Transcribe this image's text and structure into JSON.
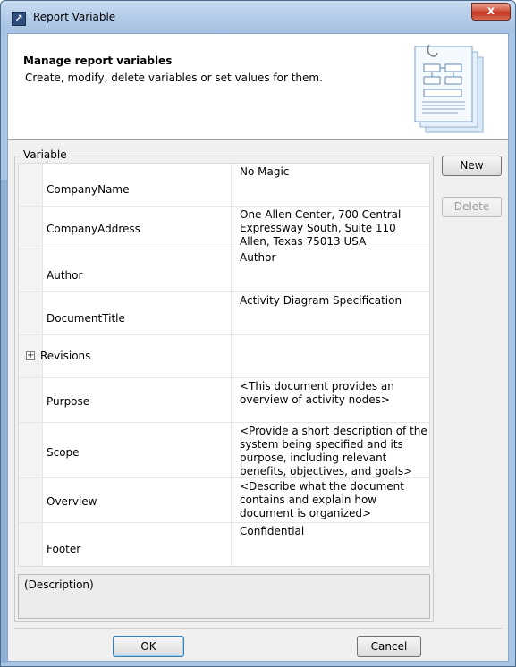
{
  "window": {
    "title": "Report Variable",
    "close_label": "x"
  },
  "header": {
    "title": "Manage report variables",
    "description": "Create, modify, delete variables or set values for them."
  },
  "group": {
    "label": "Variable"
  },
  "variables": [
    {
      "name": "CompanyName",
      "value": "No Magic",
      "expandable": false
    },
    {
      "name": "CompanyAddress",
      "value": "One Allen Center, 700 Central Expressway South, Suite 110 Allen, Texas 75013 USA",
      "expandable": false
    },
    {
      "name": "Author",
      "value": "Author",
      "expandable": false
    },
    {
      "name": "DocumentTitle",
      "value": "Activity Diagram Specification",
      "expandable": false
    },
    {
      "name": "Revisions",
      "value": "",
      "expandable": true
    },
    {
      "name": "Purpose",
      "value": "<This document provides an overview of activity nodes>",
      "expandable": false
    },
    {
      "name": "Scope",
      "value": "<Provide a short description of the system being specified and its purpose, including relevant benefits, objectives, and goals>",
      "expandable": false
    },
    {
      "name": "Overview",
      "value": "<Describe what the document contains and explain how document is organized>",
      "expandable": false
    },
    {
      "name": "Footer",
      "value": "Confidential",
      "expandable": false
    }
  ],
  "description_text": "(Description)",
  "buttons": {
    "new": "New",
    "delete": "Delete",
    "ok": "OK",
    "cancel": "Cancel"
  },
  "icons": {
    "app": "report-variable-icon",
    "header_art": "document-diagram-icon"
  }
}
